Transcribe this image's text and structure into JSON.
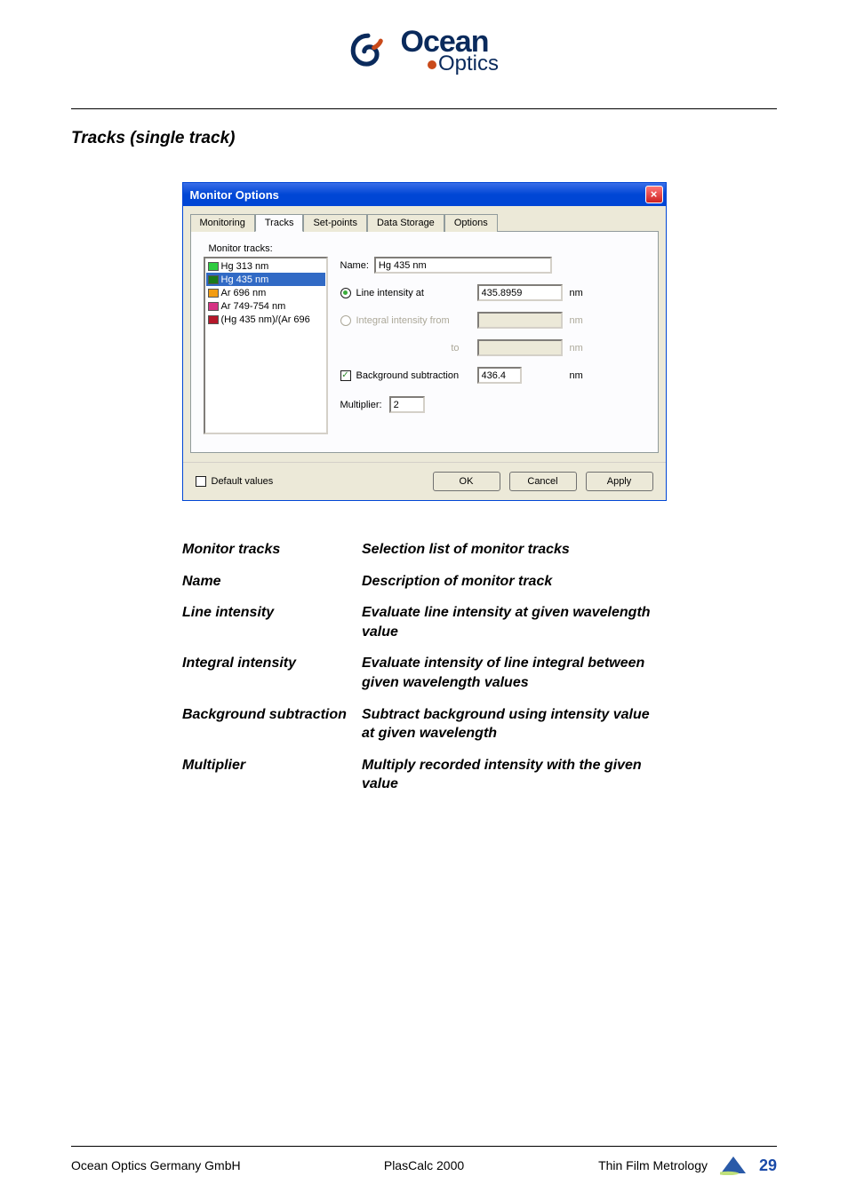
{
  "header": {
    "brand_top": "Ocean",
    "brand_bottom": "Optics"
  },
  "section_title": "Tracks (single track)",
  "dialog": {
    "title": "Monitor Options",
    "tabs": [
      "Monitoring",
      "Tracks",
      "Set-points",
      "Data Storage",
      "Options"
    ],
    "active_tab": 1,
    "monitor_tracks_label": "Monitor tracks:",
    "tracks": [
      {
        "label": "Hg 313 nm",
        "color": "#2ecc40",
        "selected": false
      },
      {
        "label": "Hg 435 nm",
        "color": "#1a7a1a",
        "selected": true
      },
      {
        "label": "Ar 696 nm",
        "color": "#f39c12",
        "selected": false
      },
      {
        "label": "Ar 749-754 nm",
        "color": "#d63384",
        "selected": false
      },
      {
        "label": "(Hg 435 nm)/(Ar 696",
        "color": "#b5172a",
        "selected": false
      }
    ],
    "name_label": "Name:",
    "name_value": "Hg 435 nm",
    "line_intensity_label": "Line intensity at",
    "line_intensity_value": "435.8959",
    "integral_label": "Integral intensity from",
    "integral_from": "",
    "integral_to_label": "to",
    "integral_to": "",
    "bg_sub_label": "Background subtraction",
    "bg_sub_value": "436.4",
    "multiplier_label": "Multiplier:",
    "multiplier_value": "2",
    "unit": "nm",
    "default_values_label": "Default values",
    "ok": "OK",
    "cancel": "Cancel",
    "apply": "Apply"
  },
  "definitions": [
    {
      "term": "Monitor tracks",
      "desc": "Selection list of monitor tracks"
    },
    {
      "term": "Name",
      "desc": "Description of monitor track"
    },
    {
      "term": "Line intensity",
      "desc": "Evaluate line intensity at given wavelength value"
    },
    {
      "term": "Integral intensity",
      "desc": "Evaluate intensity of line integral between given wavelength values"
    },
    {
      "term": "Background subtraction",
      "desc": "Subtract background using intensity value at given wavelength"
    },
    {
      "term": "Multiplier",
      "desc": "Multiply recorded intensity with the given value"
    }
  ],
  "footer": {
    "left": "Ocean Optics Germany GmbH",
    "mid": "PlasCalc 2000",
    "right": "Thin Film Metrology",
    "page": "29"
  }
}
